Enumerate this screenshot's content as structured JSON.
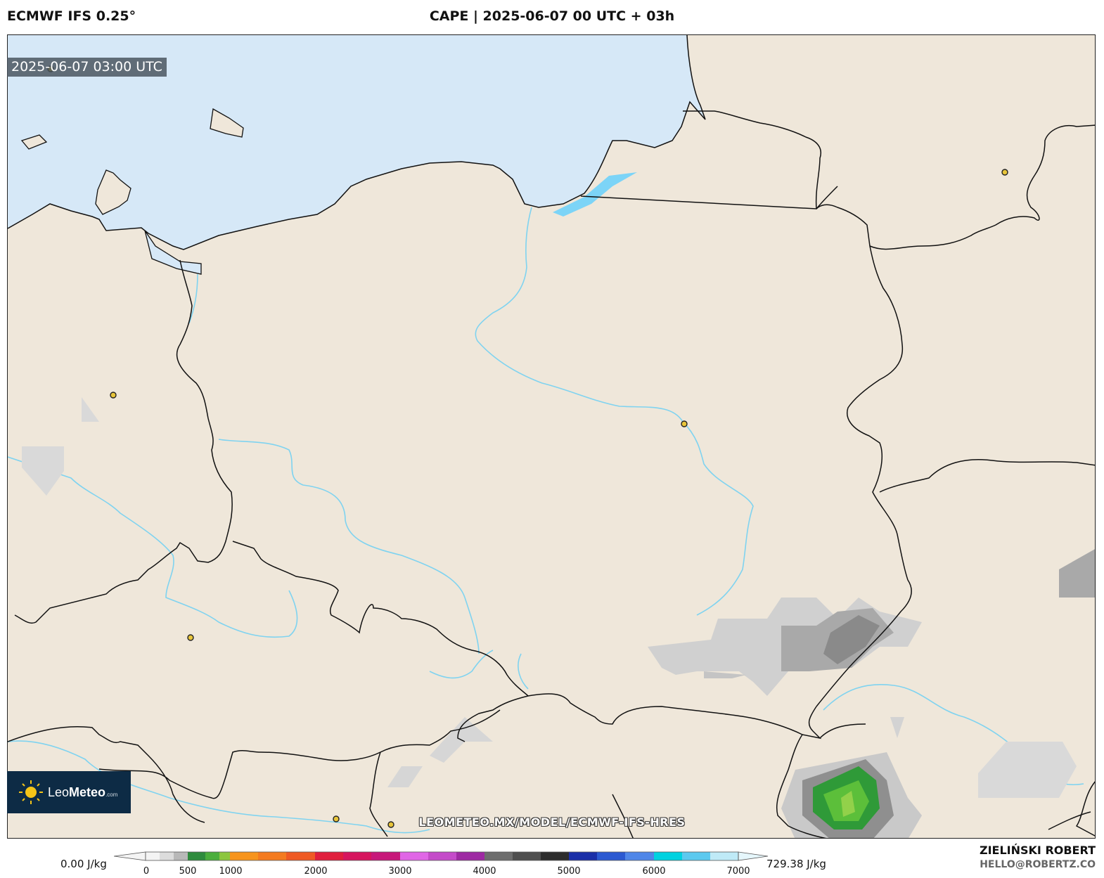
{
  "header": {
    "model": "ECMWF IFS 0.25°",
    "title": "CAPE | 2025-06-07 00 UTC + 03h"
  },
  "map": {
    "valid_time": "2025-06-07 03:00 UTC",
    "watermark": "LEOMETEO.MX/MODEL/ECMWF-IFS-HRES",
    "logo": {
      "brand_light": "Leo",
      "brand_bold": "Meteo",
      "suffix": ".com"
    },
    "colors": {
      "land": "#efe7da",
      "sea": "#d6e8f7",
      "lagoon": "#7cd4f7",
      "river": "#7fd3f0",
      "border": "#111111",
      "city": "#e8c53a"
    }
  },
  "colorbar": {
    "unit_min_label": "0.00 J/kg",
    "unit_max_label": "729.38 J/kg",
    "ticks": [
      "0",
      "500",
      "1000",
      "2000",
      "3000",
      "4000",
      "5000",
      "6000",
      "7000"
    ]
  },
  "credits": {
    "author": "ZIELIŃSKI ROBERT",
    "email": "HELLO@ROBERTZ.CO"
  }
}
